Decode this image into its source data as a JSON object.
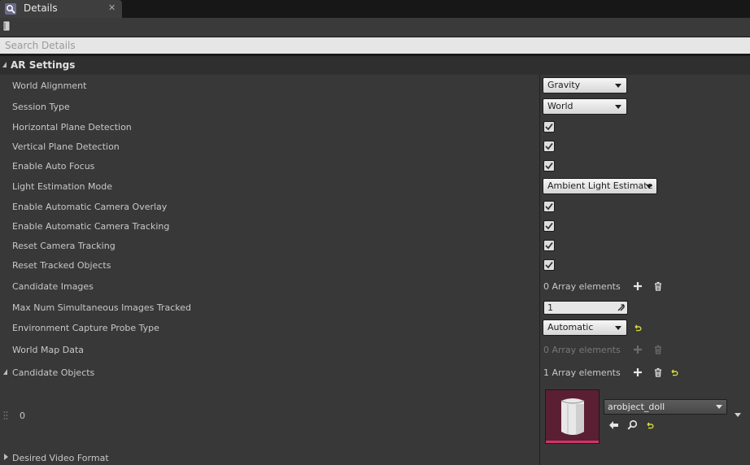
{
  "tab": {
    "title": "Details",
    "close": "✕"
  },
  "search": {
    "placeholder": "Search Details"
  },
  "section": {
    "title": "AR Settings"
  },
  "rows": {
    "world_alignment": {
      "label": "World Alignment",
      "value": "Gravity"
    },
    "session_type": {
      "label": "Session Type",
      "value": "World"
    },
    "horizontal_plane": {
      "label": "Horizontal Plane Detection",
      "checked": true
    },
    "vertical_plane": {
      "label": "Vertical Plane Detection",
      "checked": true
    },
    "auto_focus": {
      "label": "Enable Auto Focus",
      "checked": true
    },
    "light_estimation": {
      "label": "Light Estimation Mode",
      "value": "Ambient Light Estimate"
    },
    "camera_overlay": {
      "label": "Enable Automatic Camera Overlay",
      "checked": true
    },
    "camera_tracking": {
      "label": "Enable Automatic Camera Tracking",
      "checked": true
    },
    "reset_camera": {
      "label": "Reset Camera Tracking",
      "checked": true
    },
    "reset_tracked": {
      "label": "Reset Tracked Objects",
      "checked": true
    },
    "candidate_images": {
      "label": "Candidate Images",
      "value": "0 Array elements"
    },
    "max_images": {
      "label": "Max Num Simultaneous Images Tracked",
      "value": "1"
    },
    "env_probe": {
      "label": "Environment Capture Probe Type",
      "value": "Automatic"
    },
    "world_map": {
      "label": "World Map Data",
      "value": "0 Array elements"
    },
    "candidate_objects": {
      "label": "Candidate Objects",
      "value": "1 Array elements"
    },
    "element_0": {
      "index": "0",
      "asset": "arobject_doll"
    },
    "video_format": {
      "label": "Desired Video Format"
    }
  },
  "icons": {
    "details_tab": "details-magnifier-icon",
    "lock": "lock-icon",
    "add": "plus-icon",
    "delete": "trash-icon",
    "reset": "reset-arrow-icon",
    "use_selected": "left-arrow-icon",
    "browse": "magnifier-icon"
  },
  "colors": {
    "panel_bg": "#383838",
    "thumbnail_bg": "#5a1f33",
    "thumbnail_accent": "#d4336a",
    "reset_yellow": "#d8d83a"
  }
}
